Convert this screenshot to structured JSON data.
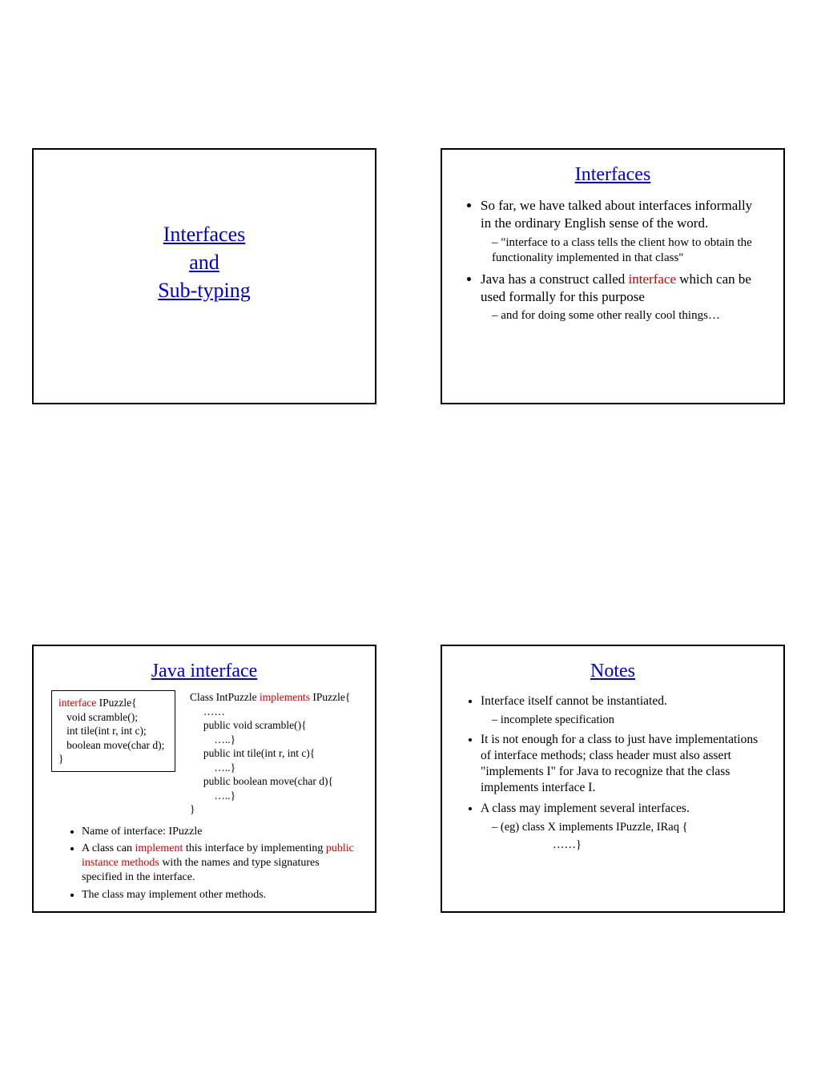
{
  "slide1": {
    "line1": "Interfaces",
    "line2": "and",
    "line3": "Sub-typing"
  },
  "slide2": {
    "title": "Interfaces",
    "b1": "So far, we have talked about interfaces informally in the ordinary English sense of the word.",
    "b1s1": "\"interface to a class tells the client how to obtain the functionality implemented in that class\"",
    "b2a": "Java has a construct called ",
    "b2red": "interface",
    "b2b": " which can be used formally for this purpose",
    "b2s1": "and for doing some other really cool things…"
  },
  "slide3": {
    "title": "Java interface",
    "left_red": "interface",
    "left_rest": " IPuzzle{\n   void scramble();\n   int tile(int r, int c);\n   boolean move(char d);\n}",
    "right_a": "Class IntPuzzle ",
    "right_red": "implements",
    "right_b": " IPuzzle{\n     ……\n     public void scramble(){\n         …..}\n     public int tile(int r, int c){\n         …..}\n     public boolean move(char d){\n         …..}\n}",
    "p1": "Name of interface: IPuzzle",
    "p2a": "A class can ",
    "p2red1": "implement",
    "p2b": " this interface by implementing ",
    "p2red2": "public instance methods",
    "p2c": " with the names and type signatures specified in the interface.",
    "p3": "The class may implement other methods."
  },
  "slide4": {
    "title": "Notes",
    "b1": "Interface itself cannot be instantiated.",
    "b1s1": "incomplete specification",
    "b2": "It is not enough for a class to just have implementations of interface methods; class header must also assert \"implements I\" for Java to recognize that the class implements interface I.",
    "b3": "A class may implement several interfaces.",
    "b3s1": "(eg) class X implements IPuzzle, IRaq {",
    "b3cont": "……}"
  }
}
